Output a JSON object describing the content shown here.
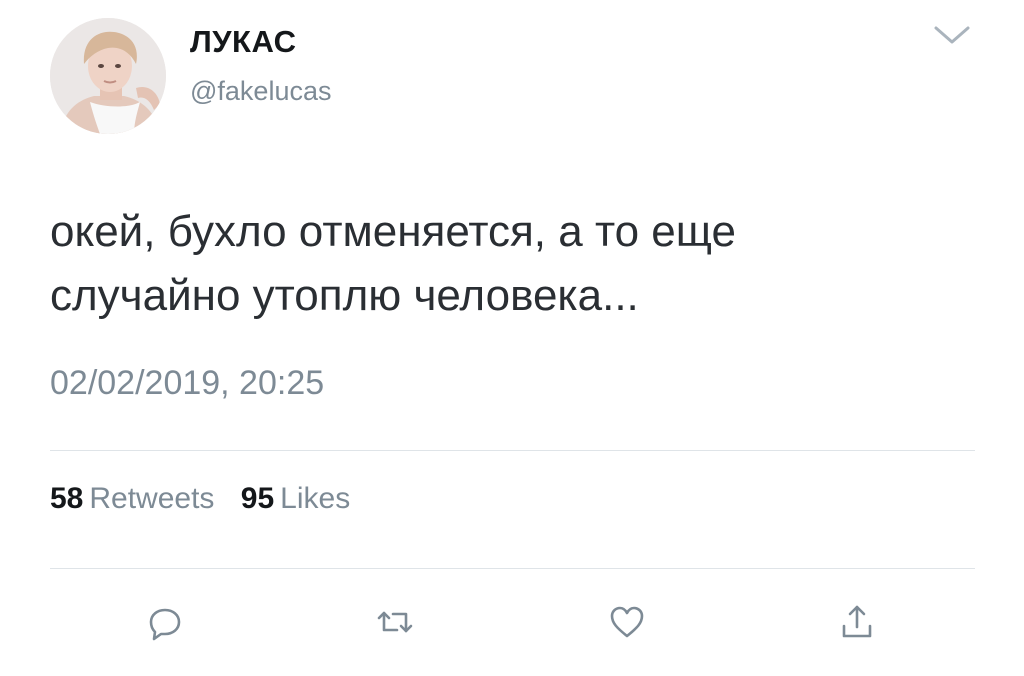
{
  "author": {
    "name": "ЛУКАС",
    "handle": "@fakelucas"
  },
  "tweet": {
    "text_line1": "окей, бухло отменяется, а то еще",
    "text_line2": "случайно утоплю человека...",
    "timestamp": "02/02/2019, 20:25"
  },
  "stats": {
    "retweets_count": "58",
    "retweets_label": "Retweets",
    "likes_count": "95",
    "likes_label": "Likes"
  },
  "icons": {
    "more": "chevron-down-icon",
    "reply": "reply-icon",
    "retweet": "retweet-icon",
    "like": "heart-icon",
    "share": "share-icon"
  },
  "colors": {
    "text": "#14171a",
    "secondary": "#7d8a95",
    "divider": "#dfe4e8",
    "icon": "#7d8a95"
  }
}
